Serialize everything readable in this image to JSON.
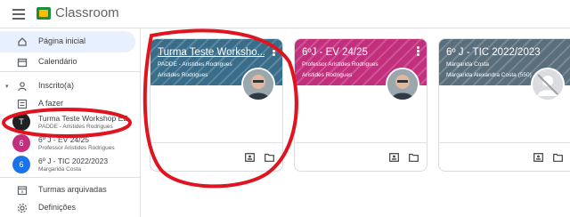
{
  "app": {
    "title": "Classroom"
  },
  "sidebar": {
    "home_label": "Página inicial",
    "calendar_label": "Calendário",
    "enrolled_label": "Inscrito(a)",
    "todo_label": "A fazer",
    "classes": [
      {
        "initial": "T",
        "name": "Turma Teste Workshop EE",
        "sub": "PADDE - Aristides Rodrigues",
        "color": "#202124"
      },
      {
        "initial": "6",
        "name": "6º J - EV 24/25",
        "sub": "Professor Aristides Rodrigues",
        "color": "#c2307d"
      },
      {
        "initial": "6",
        "name": "6º J - TIC 2022/2023",
        "sub": "Margarida Costa",
        "color": "#1a73e8"
      }
    ],
    "archived_label": "Turmas arquivadas",
    "settings_label": "Definições"
  },
  "cards": [
    {
      "title": "Turma Teste Worksho...",
      "sub": "PADDE - Aristides Rodrigues",
      "teacher": "Aristides Rodrigues",
      "color": "#3a6d8a"
    },
    {
      "title": "6ºJ - EV 24/25",
      "sub": "Professor Aristides Rodrigues",
      "teacher": "Aristides Rodrigues",
      "color": "#c2307d"
    },
    {
      "title": "6º J - TIC 2022/2023",
      "sub": "Margarida Costa",
      "teacher": "Margarida Alexandra Costa (550)",
      "color": "#5a6e7c"
    }
  ],
  "colors": {
    "accent": "#1a73e8",
    "annotation": "#e0141e"
  }
}
